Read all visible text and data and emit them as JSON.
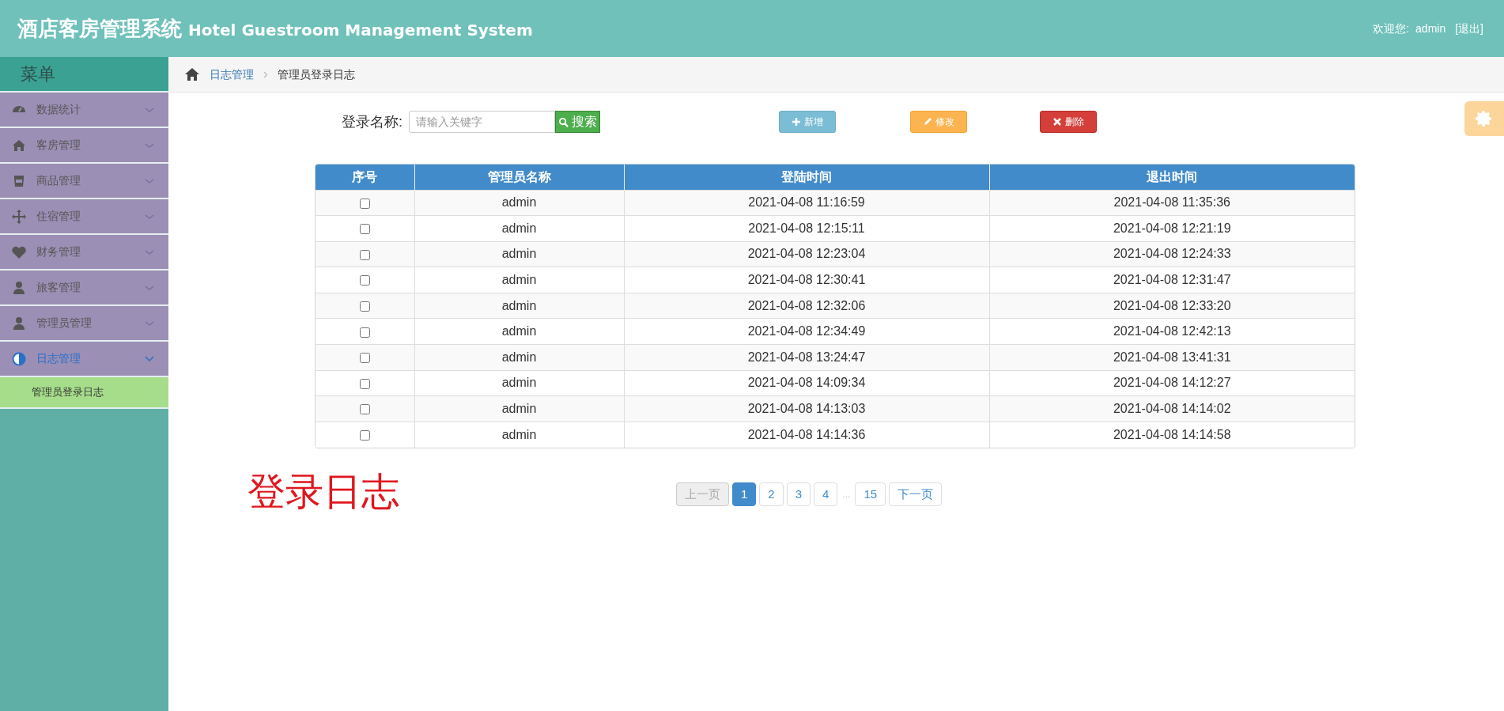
{
  "header": {
    "title": "酒店客房管理系统",
    "subtitle": "Hotel Guestroom Management System",
    "welcome": "欢迎您:",
    "user": "admin",
    "logout": "[退出]"
  },
  "sidebar": {
    "title": "菜单",
    "items": [
      {
        "label": "数据统计",
        "kind": "dashboard",
        "expanded": false,
        "selected": false
      },
      {
        "label": "客房管理",
        "kind": "home",
        "expanded": false,
        "selected": false
      },
      {
        "label": "商品管理",
        "kind": "bucket",
        "expanded": false,
        "selected": false
      },
      {
        "label": "住宿管理",
        "kind": "move",
        "expanded": false,
        "selected": false
      },
      {
        "label": "财务管理",
        "kind": "heart",
        "expanded": false,
        "selected": false
      },
      {
        "label": "旅客管理",
        "kind": "user",
        "expanded": false,
        "selected": false
      },
      {
        "label": "管理员管理",
        "kind": "user",
        "expanded": false,
        "selected": false
      },
      {
        "label": "日志管理",
        "kind": "contrast",
        "expanded": true,
        "selected": true,
        "children": [
          {
            "label": "管理员登录日志",
            "selected": true
          }
        ]
      }
    ]
  },
  "breadcrumb": [
    "日志管理",
    "管理员登录日志"
  ],
  "toolbar": {
    "search_label": "登录名称:",
    "search_placeholder": "请输入关键字",
    "search_button": "搜索",
    "buttons": [
      {
        "label": "新增",
        "kind": "add"
      },
      {
        "label": "修改",
        "kind": "edit"
      },
      {
        "label": "删除",
        "kind": "delete"
      }
    ]
  },
  "table": {
    "columns": [
      "序号",
      "管理员名称",
      "登陆时间",
      "退出时间"
    ],
    "rows": [
      {
        "checked": false,
        "name": "admin",
        "login": "2021-04-08 11:16:59",
        "logout": "2021-04-08 11:35:36"
      },
      {
        "checked": false,
        "name": "admin",
        "login": "2021-04-08 12:15:11",
        "logout": "2021-04-08 12:21:19"
      },
      {
        "checked": false,
        "name": "admin",
        "login": "2021-04-08 12:23:04",
        "logout": "2021-04-08 12:24:33"
      },
      {
        "checked": false,
        "name": "admin",
        "login": "2021-04-08 12:30:41",
        "logout": "2021-04-08 12:31:47"
      },
      {
        "checked": false,
        "name": "admin",
        "login": "2021-04-08 12:32:06",
        "logout": "2021-04-08 12:33:20"
      },
      {
        "checked": false,
        "name": "admin",
        "login": "2021-04-08 12:34:49",
        "logout": "2021-04-08 12:42:13"
      },
      {
        "checked": false,
        "name": "admin",
        "login": "2021-04-08 13:24:47",
        "logout": "2021-04-08 13:41:31"
      },
      {
        "checked": false,
        "name": "admin",
        "login": "2021-04-08 14:09:34",
        "logout": "2021-04-08 14:12:27"
      },
      {
        "checked": false,
        "name": "admin",
        "login": "2021-04-08 14:13:03",
        "logout": "2021-04-08 14:14:02"
      },
      {
        "checked": false,
        "name": "admin",
        "login": "2021-04-08 14:14:36",
        "logout": "2021-04-08 14:14:58"
      }
    ]
  },
  "caption": "登录日志",
  "pagination": [
    {
      "label": "上一页",
      "kind": "prev",
      "disabled": true,
      "selected": false
    },
    {
      "label": "1",
      "kind": "page",
      "selected": true
    },
    {
      "label": "2",
      "kind": "page",
      "selected": false
    },
    {
      "label": "3",
      "kind": "page",
      "selected": false
    },
    {
      "label": "4",
      "kind": "page",
      "selected": false
    },
    {
      "label": "...",
      "kind": "gap"
    },
    {
      "label": "15",
      "kind": "page",
      "selected": false
    },
    {
      "label": "下一页",
      "kind": "next",
      "disabled": false,
      "selected": false
    }
  ]
}
